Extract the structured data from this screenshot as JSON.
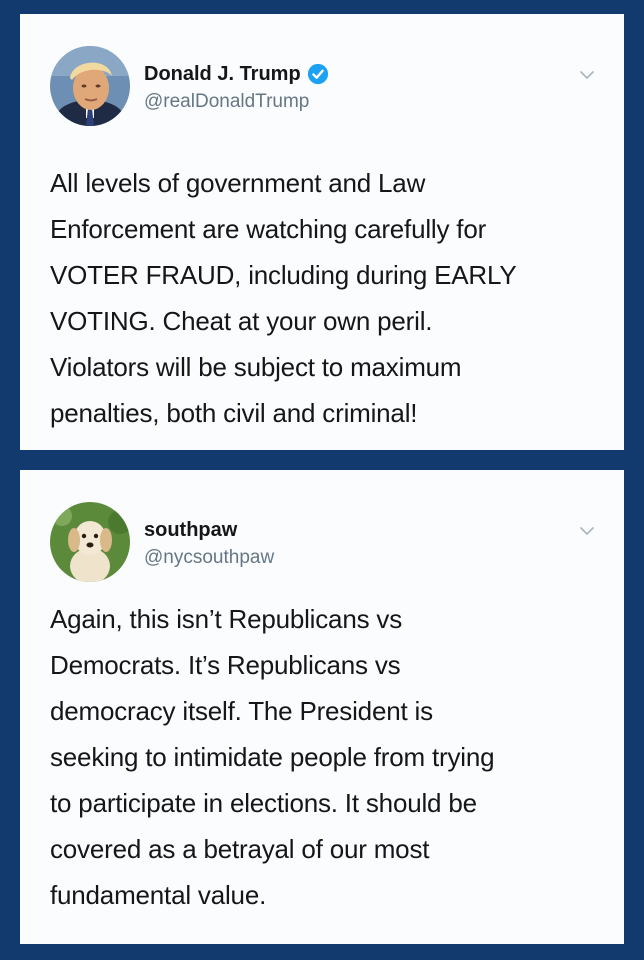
{
  "tweets": [
    {
      "author_name": "Donald J. Trump",
      "author_handle": "@realDonaldTrump",
      "verified": true,
      "avatar_icon": "portrait-avatar",
      "text": "All levels of government and Law\nEnforcement are watching carefully for\nVOTER FRAUD, including during EARLY\nVOTING. Cheat at your own peril.\nViolators will be subject to maximum\npenalties, both civil and criminal!"
    },
    {
      "author_name": "southpaw",
      "author_handle": "@nycsouthpaw",
      "verified": false,
      "avatar_icon": "puppy-avatar",
      "text": "Again, this isn’t Republicans vs\nDemocrats. It’s Republicans vs\ndemocracy itself. The President is\nseeking to intimidate people from trying\nto participate in elections. It should be\ncovered as a betrayal of our most\nfundamental value."
    }
  ],
  "colors": {
    "background": "#123a6e",
    "card": "#fbfcfd",
    "text": "#14171a",
    "handle": "#657786",
    "verified": "#1da1f2"
  }
}
